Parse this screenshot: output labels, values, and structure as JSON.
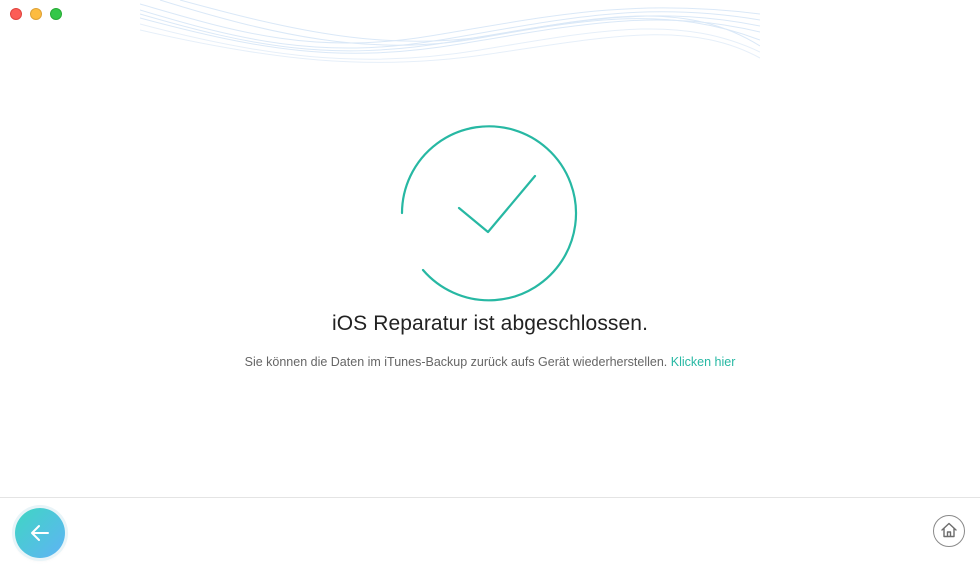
{
  "window": {
    "controls": [
      "close",
      "minimize",
      "zoom"
    ]
  },
  "main": {
    "status_icon": "checkmark-circle-icon",
    "title": "iOS Reparatur ist abgeschlossen.",
    "message": "Sie können die Daten im iTunes-Backup zurück aufs Gerät wiederherstellen.",
    "link_label": "Klicken hier"
  },
  "footer": {
    "back_icon": "arrow-left-icon",
    "home_icon": "home-icon"
  },
  "colors": {
    "accent": "#27b8a3",
    "back_gradient_start": "#3fd6c3",
    "back_gradient_end": "#5fb3f5"
  }
}
